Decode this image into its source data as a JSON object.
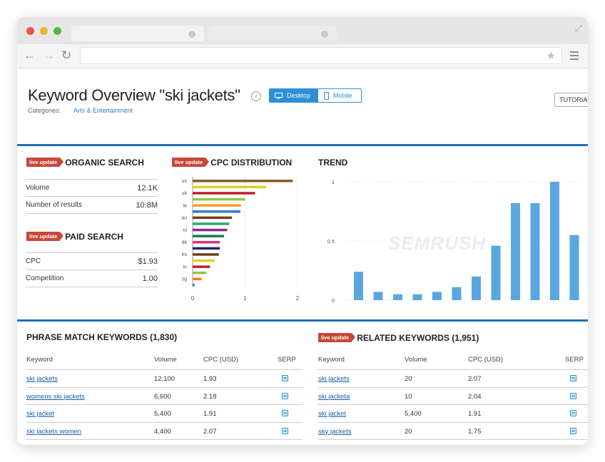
{
  "page": {
    "title": "Keyword Overview \"ski jackets\"",
    "categories_label": "Categories:",
    "category": "Arts & Entertainment",
    "desktop_label": "Desktop",
    "mobile_label": "Mobile",
    "tutorial_label": "TUTORIAL"
  },
  "badge": "live update",
  "organic": {
    "title": "ORGANIC SEARCH",
    "rows": [
      {
        "label": "Volume",
        "value": "12.1K"
      },
      {
        "label": "Number of results",
        "value": "10.8M"
      }
    ]
  },
  "paid": {
    "title": "PAID SEARCH",
    "rows": [
      {
        "label": "CPC",
        "value": "$1.93"
      },
      {
        "label": "Competition",
        "value": "1.00"
      }
    ]
  },
  "cpc": {
    "title": "CPC DISTRIBUTION"
  },
  "trend": {
    "title": "TREND"
  },
  "watermark": "SEMRUSH",
  "chart_data": [
    {
      "type": "bar",
      "orientation": "horizontal",
      "title": "CPC DISTRIBUTION",
      "categories": [
        "us",
        "",
        "uk",
        "",
        "ie",
        "",
        "au",
        "",
        "nl",
        "",
        "dk",
        "",
        "es",
        "",
        "in",
        "",
        "sg",
        ""
      ],
      "values": [
        1.91,
        1.4,
        1.19,
        1.0,
        0.92,
        0.91,
        0.75,
        0.7,
        0.66,
        0.6,
        0.52,
        0.52,
        0.5,
        0.42,
        0.33,
        0.26,
        0.17,
        0.04
      ],
      "colors": [
        "#8b5a2b",
        "#d4d42a",
        "#c0202a",
        "#9bc53d",
        "#f0a030",
        "#2d7ec9",
        "#7a3a1a",
        "#2aa876",
        "#8e2a8e",
        "#1f7a4f",
        "#e0307a",
        "#1f2a6b",
        "#6b3d1f",
        "#d4d42a",
        "#c0202a",
        "#9bc53d",
        "#f07a1a",
        "#2d7ec9"
      ],
      "xticks": [
        "0",
        "1",
        "2"
      ],
      "xlim": [
        0,
        2
      ]
    },
    {
      "type": "bar",
      "title": "TREND",
      "values": [
        0.24,
        0.07,
        0.05,
        0.05,
        0.07,
        0.11,
        0.2,
        0.46,
        0.82,
        0.82,
        1.0,
        0.55
      ],
      "yticks": [
        "1",
        "0.5",
        "0"
      ],
      "ylim": [
        0,
        1
      ],
      "color": "#5aa7e0"
    }
  ],
  "phrase": {
    "title": "PHRASE MATCH KEYWORDS (1,830)",
    "headers": {
      "keyword": "Keyword",
      "volume": "Volume",
      "cpc": "CPC (USD)",
      "serp": "SERP"
    },
    "rows": [
      {
        "keyword": "ski jackets",
        "volume": "12,100",
        "cpc": "1.93"
      },
      {
        "keyword": "womens ski jackets",
        "volume": "6,600",
        "cpc": "2.18"
      },
      {
        "keyword": "ski jacket",
        "volume": "5,400",
        "cpc": "1.91"
      },
      {
        "keyword": "ski jackets women",
        "volume": "4,400",
        "cpc": "2.07"
      }
    ]
  },
  "related": {
    "title": "RELATED KEYWORDS (1,951)",
    "headers": {
      "keyword": "Keyword",
      "volume": "Volume",
      "cpc": "CPC (USD)",
      "serp": "SERP"
    },
    "rows": [
      {
        "keyword": "ski jackets",
        "volume": "20",
        "cpc": "2.07"
      },
      {
        "keyword": "ski jacketa",
        "volume": "10",
        "cpc": "2.04"
      },
      {
        "keyword": "ski jacket",
        "volume": "5,400",
        "cpc": "1.91"
      },
      {
        "keyword": "sky jackets",
        "volume": "20",
        "cpc": "1.75"
      }
    ]
  }
}
